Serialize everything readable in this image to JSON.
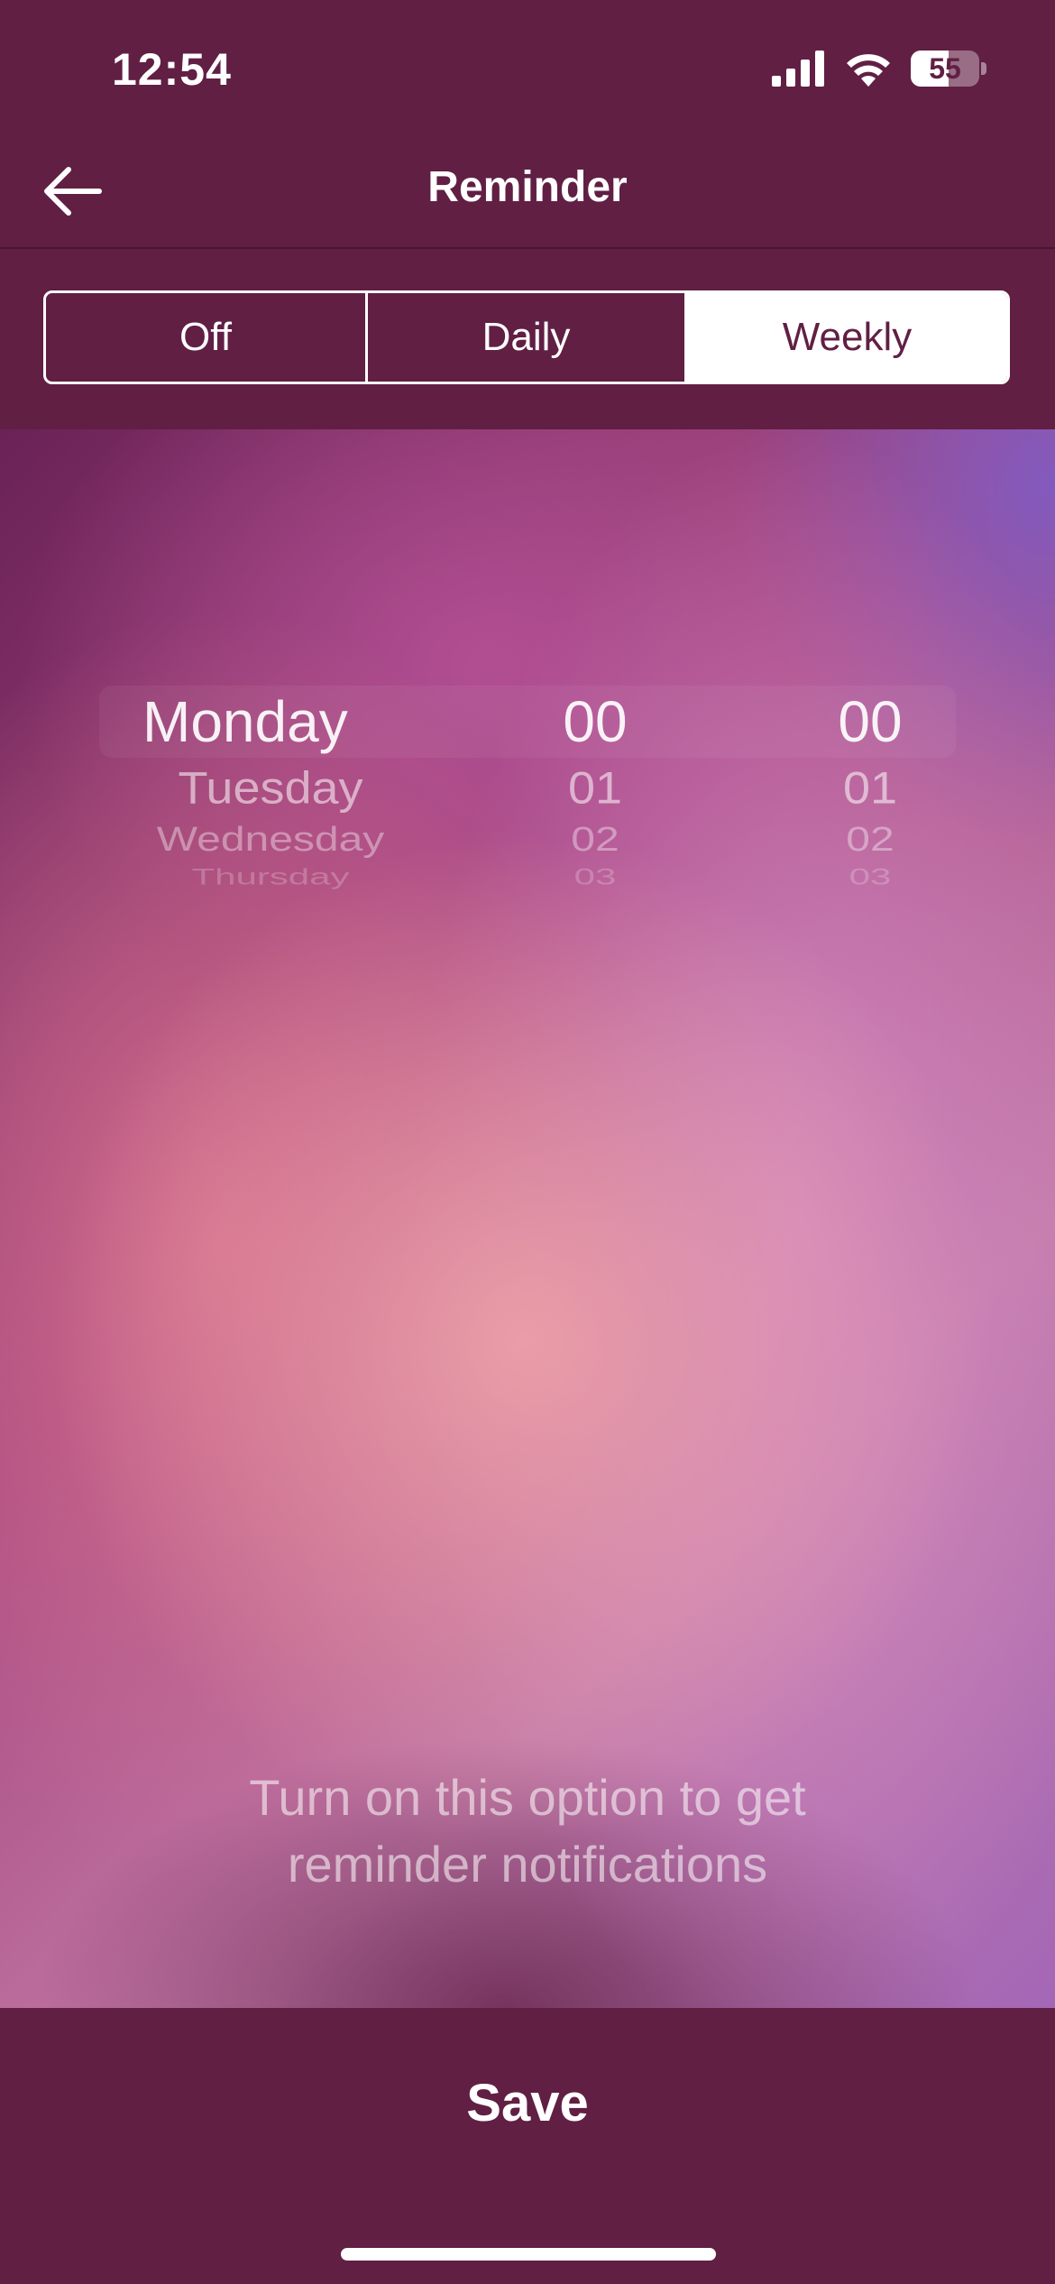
{
  "status_bar": {
    "time": "12:54",
    "battery": "55"
  },
  "nav": {
    "title": "Reminder",
    "back_icon": "arrow-left-icon"
  },
  "segments": {
    "options": [
      "Off",
      "Daily",
      "Weekly"
    ],
    "selected": "Weekly"
  },
  "picker": {
    "days": [
      "Monday",
      "Tuesday",
      "Wednesday",
      "Thursday"
    ],
    "hours": [
      "00",
      "01",
      "02",
      "03"
    ],
    "minutes": [
      "00",
      "01",
      "02",
      "03"
    ]
  },
  "hint": {
    "line1": "Turn on this option to get",
    "line2": "reminder notifications"
  },
  "footer": {
    "save_label": "Save"
  },
  "colors": {
    "primary": "#611f44",
    "text": "#ffffff"
  }
}
